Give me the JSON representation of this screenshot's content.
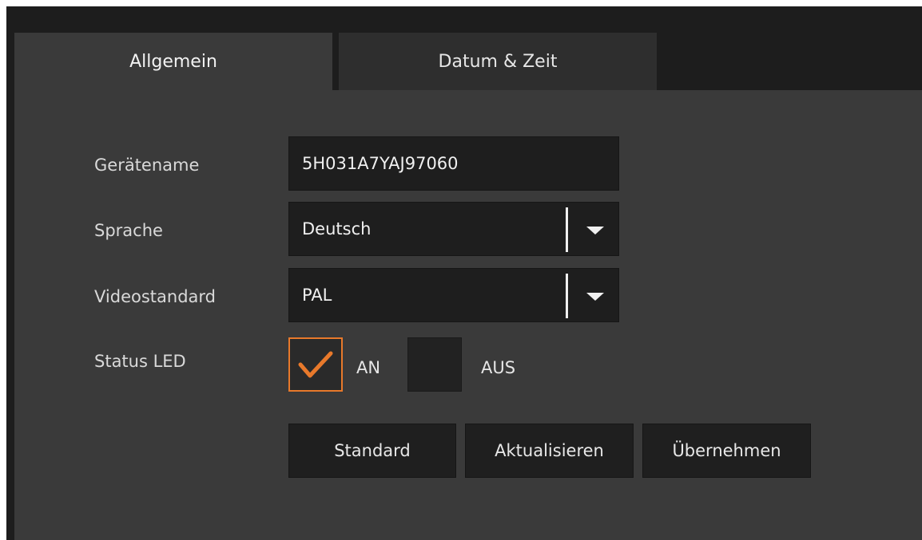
{
  "tabs": {
    "general": "Allgemein",
    "datetime": "Datum & Zeit"
  },
  "form": {
    "device_name": {
      "label": "Gerätename",
      "value": "5H031A7YAJ97060"
    },
    "language": {
      "label": "Sprache",
      "value": "Deutsch"
    },
    "video_standard": {
      "label": "Videostandard",
      "value": "PAL"
    },
    "status_led": {
      "label": "Status LED",
      "on_label": "AN",
      "off_label": "AUS",
      "on_checked": true,
      "off_checked": false
    }
  },
  "buttons": {
    "default": "Standard",
    "refresh": "Aktualisieren",
    "apply": "Übernehmen"
  },
  "colors": {
    "accent": "#e8792b"
  }
}
